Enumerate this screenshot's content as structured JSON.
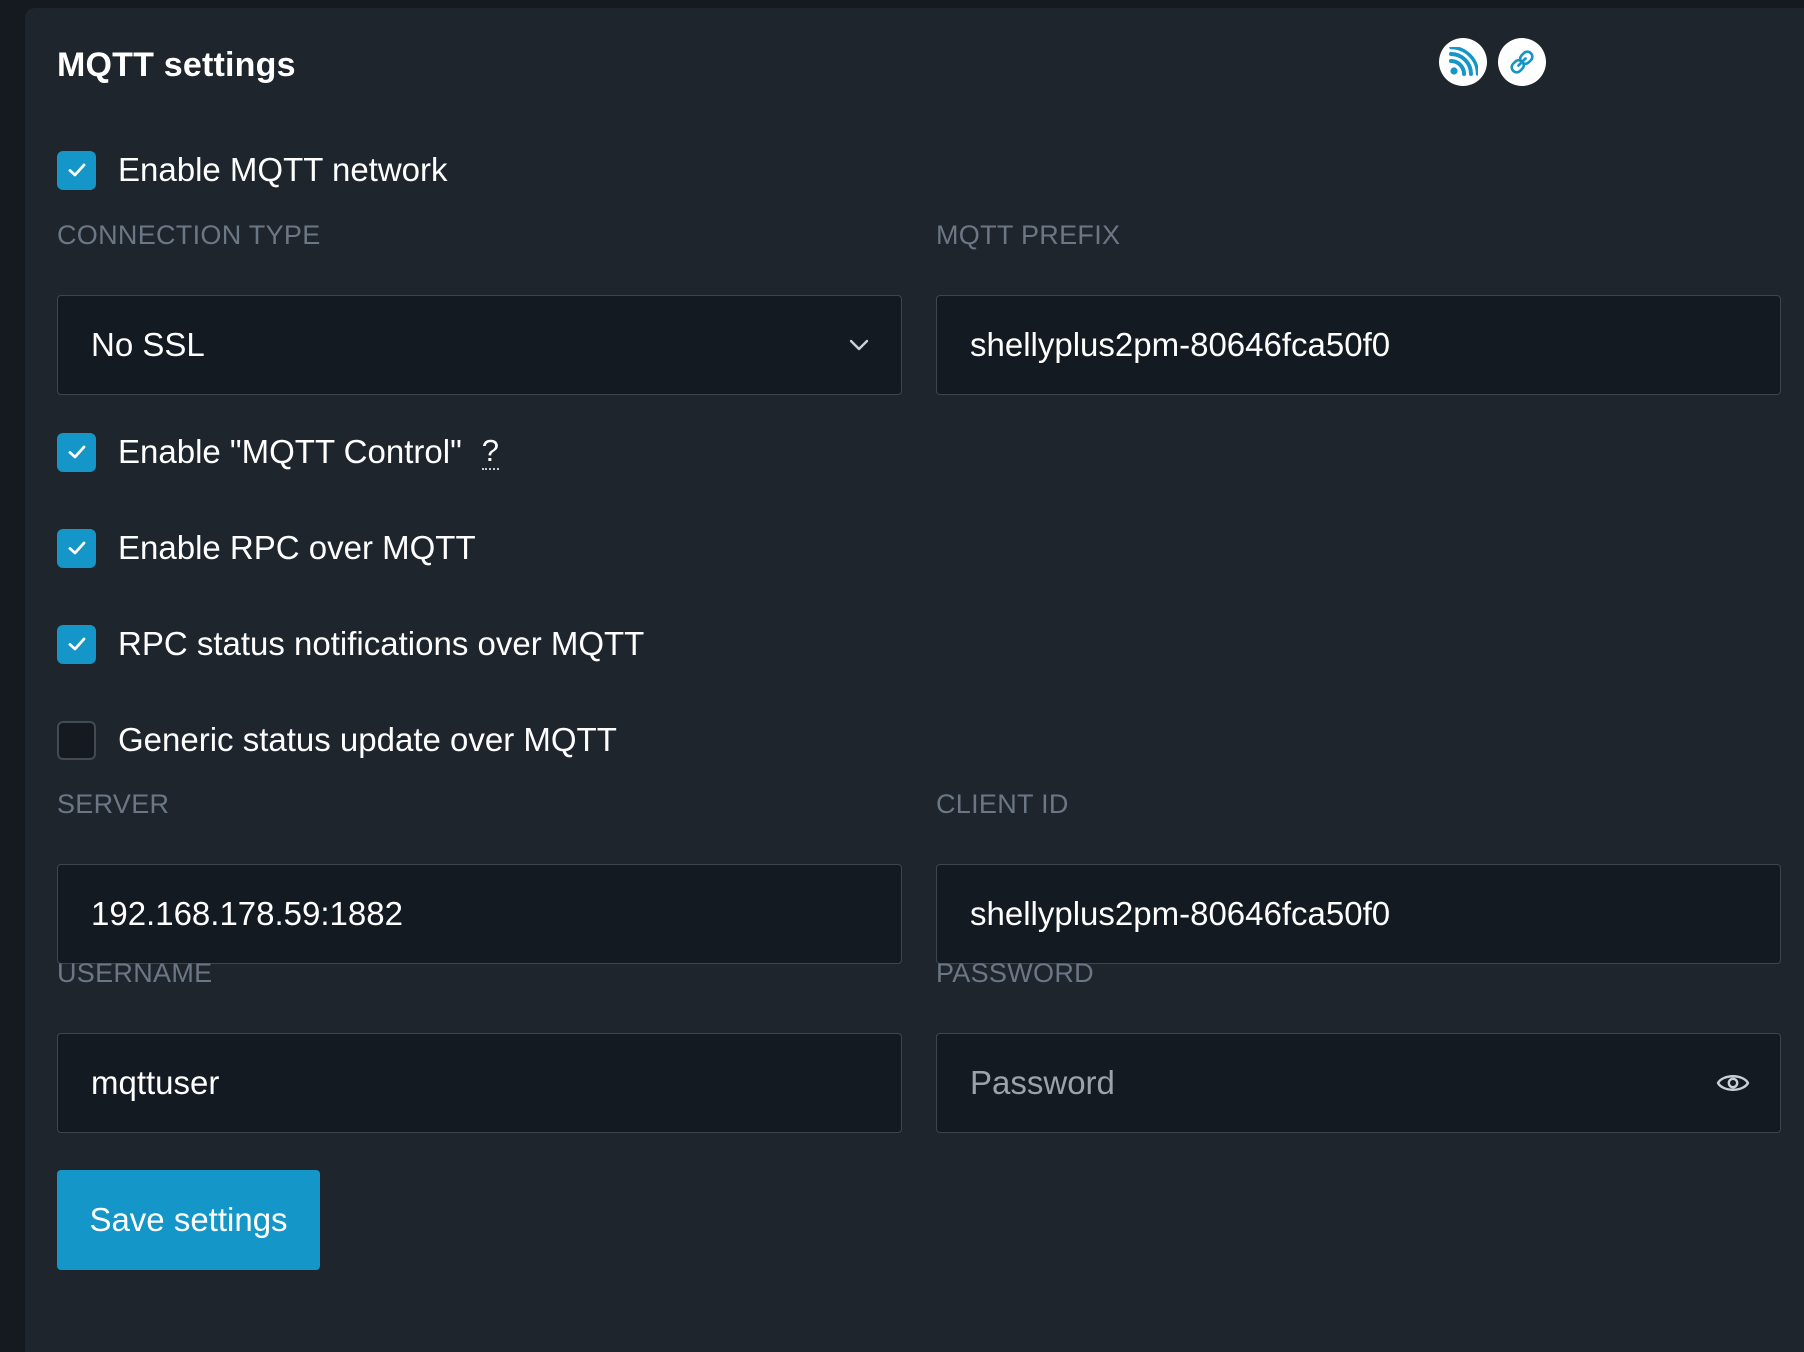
{
  "panel": {
    "title": "MQTT settings",
    "header_icons": [
      "rss-feed-icon",
      "link-icon"
    ]
  },
  "options": {
    "enable_mqtt": {
      "label": "Enable MQTT network",
      "checked": true
    },
    "enable_control": {
      "label": "Enable \"MQTT Control\"",
      "checked": true,
      "help": "?"
    },
    "enable_rpc": {
      "label": "Enable RPC over MQTT",
      "checked": true
    },
    "rpc_status": {
      "label": "RPC status notifications over MQTT",
      "checked": true
    },
    "generic_status": {
      "label": "Generic status update over MQTT",
      "checked": false
    }
  },
  "fields": {
    "connection_type": {
      "label": "CONNECTION TYPE",
      "value": "No SSL"
    },
    "mqtt_prefix": {
      "label": "MQTT PREFIX",
      "value": "shellyplus2pm-80646fca50f0"
    },
    "server": {
      "label": "SERVER",
      "value": "192.168.178.59:1882"
    },
    "client_id": {
      "label": "CLIENT ID",
      "value": "shellyplus2pm-80646fca50f0"
    },
    "username": {
      "label": "USERNAME",
      "value": "mqttuser"
    },
    "password": {
      "label": "PASSWORD",
      "value": "",
      "placeholder": "Password"
    }
  },
  "actions": {
    "save_label": "Save settings"
  },
  "colors": {
    "accent": "#1496c8",
    "panel_bg": "#1f252d",
    "page_bg": "#151a20",
    "input_bg": "#141a21",
    "label_muted": "#6c7785"
  }
}
